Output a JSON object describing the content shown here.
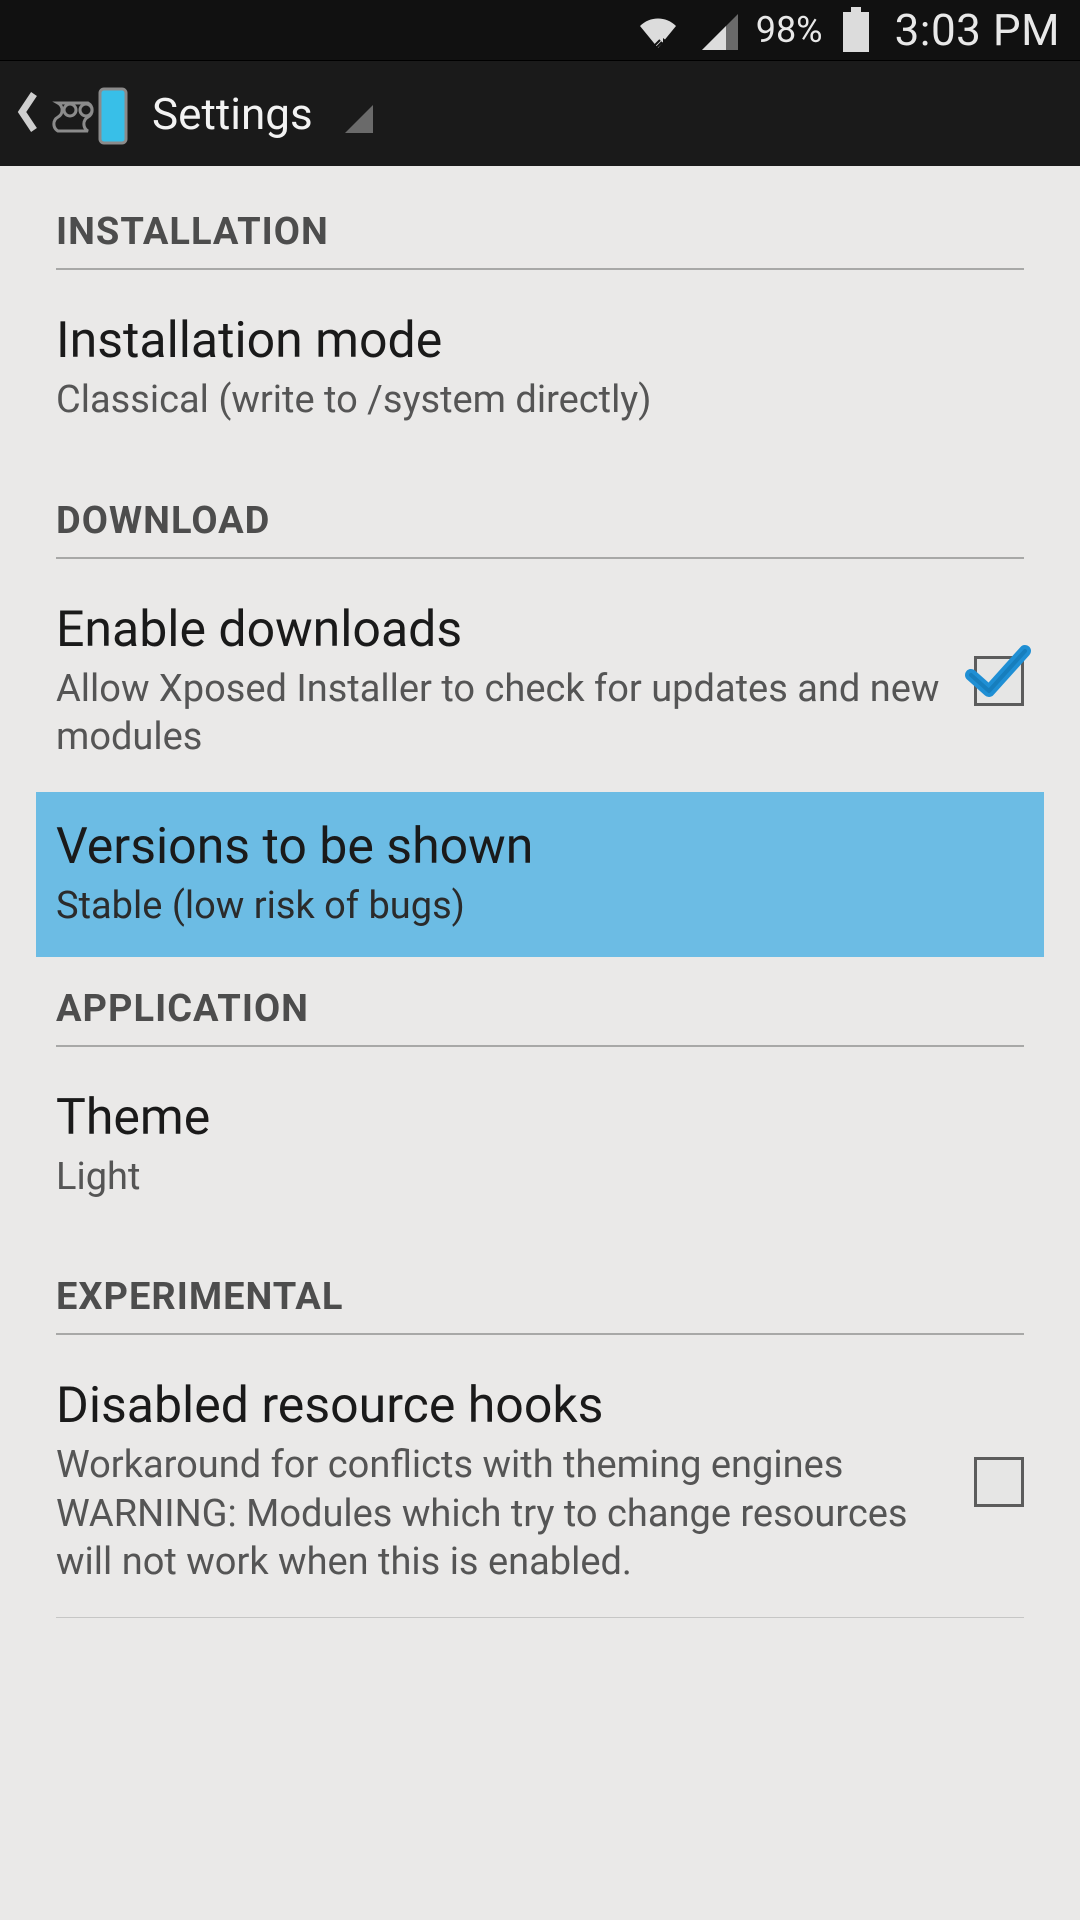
{
  "status_bar": {
    "battery_pct": "98%",
    "time": "3:03 PM"
  },
  "action_bar": {
    "title": "Settings"
  },
  "sections": {
    "installation": {
      "header": "INSTALLATION",
      "mode_title": "Installation mode",
      "mode_value": "Classical (write to /system directly)"
    },
    "download": {
      "header": "DOWNLOAD",
      "enable_title": "Enable downloads",
      "enable_desc": "Allow Xposed Installer to check for updates and new modules",
      "enable_checked": true,
      "versions_title": "Versions to be shown",
      "versions_value": "Stable (low risk of bugs)"
    },
    "application": {
      "header": "APPLICATION",
      "theme_title": "Theme",
      "theme_value": "Light"
    },
    "experimental": {
      "header": "EXPERIMENTAL",
      "hooks_title": "Disabled resource hooks",
      "hooks_desc": "Workaround for conflicts with theming engines\nWARNING: Modules which try to change resources will not work when this is enabled.",
      "hooks_checked": false
    }
  }
}
